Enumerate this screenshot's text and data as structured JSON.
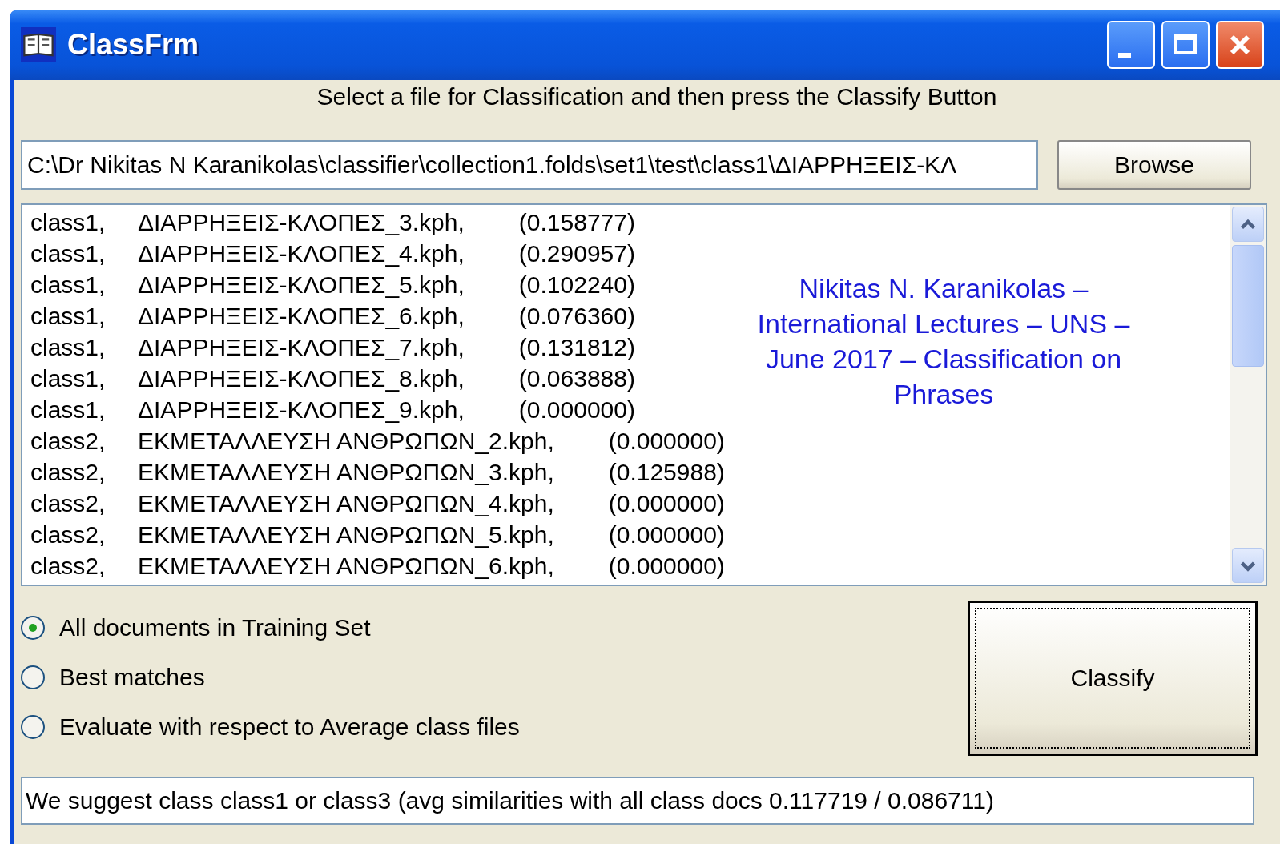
{
  "window": {
    "title": "ClassFrm"
  },
  "instruction": "Select a file for Classification and then press the Classify Button",
  "path_field": {
    "value": "C:\\Dr Nikitas N Karanikolas\\classifier\\collection1.folds\\set1\\test\\class1\\ΔΙΑΡΡΗΞΕΙΣ-ΚΛ"
  },
  "browse_button": "Browse",
  "results": [
    {
      "class": "class1,",
      "file": "ΔΙΑΡΡΗΞΕΙΣ-ΚΛΟΠΕΣ_3.kph,",
      "score": "(0.158777)"
    },
    {
      "class": "class1,",
      "file": "ΔΙΑΡΡΗΞΕΙΣ-ΚΛΟΠΕΣ_4.kph,",
      "score": "(0.290957)"
    },
    {
      "class": "class1,",
      "file": "ΔΙΑΡΡΗΞΕΙΣ-ΚΛΟΠΕΣ_5.kph,",
      "score": "(0.102240)"
    },
    {
      "class": "class1,",
      "file": "ΔΙΑΡΡΗΞΕΙΣ-ΚΛΟΠΕΣ_6.kph,",
      "score": "(0.076360)"
    },
    {
      "class": "class1,",
      "file": "ΔΙΑΡΡΗΞΕΙΣ-ΚΛΟΠΕΣ_7.kph,",
      "score": "(0.131812)"
    },
    {
      "class": "class1,",
      "file": "ΔΙΑΡΡΗΞΕΙΣ-ΚΛΟΠΕΣ_8.kph,",
      "score": "(0.063888)"
    },
    {
      "class": "class1,",
      "file": "ΔΙΑΡΡΗΞΕΙΣ-ΚΛΟΠΕΣ_9.kph,",
      "score": "(0.000000)"
    },
    {
      "class": "class2,",
      "file": "ΕΚΜΕΤΑΛΛΕΥΣΗ ΑΝΘΡΩΠΩΝ_2.kph,",
      "score": "(0.000000)"
    },
    {
      "class": "class2,",
      "file": "ΕΚΜΕΤΑΛΛΕΥΣΗ ΑΝΘΡΩΠΩΝ_3.kph,",
      "score": "(0.125988)"
    },
    {
      "class": "class2,",
      "file": "ΕΚΜΕΤΑΛΛΕΥΣΗ ΑΝΘΡΩΠΩΝ_4.kph,",
      "score": "(0.000000)"
    },
    {
      "class": "class2,",
      "file": "ΕΚΜΕΤΑΛΛΕΥΣΗ ΑΝΘΡΩΠΩΝ_5.kph,",
      "score": "(0.000000)"
    },
    {
      "class": "class2,",
      "file": "ΕΚΜΕΤΑΛΛΕΥΣΗ ΑΝΘΡΩΠΩΝ_6.kph,",
      "score": "(0.000000)"
    }
  ],
  "caption": "Nikitas N. Karanikolas – International Lectures – UNS – June 2017 – Classification on Phrases",
  "options": [
    {
      "label": "All documents in Training Set",
      "selected": true
    },
    {
      "label": "Best matches",
      "selected": false
    },
    {
      "label": "Evaluate with respect to Average class files",
      "selected": false
    }
  ],
  "classify_button": "Classify",
  "status": "We suggest class class1 or class3 (avg similarities with all class docs 0.117719 / 0.086711)"
}
